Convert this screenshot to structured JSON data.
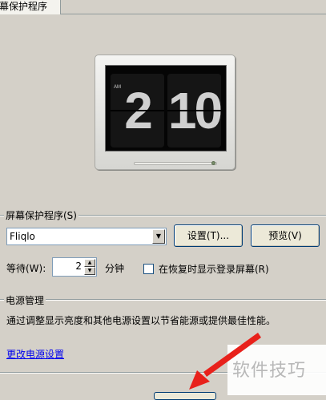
{
  "tab": {
    "label": "幕保护程序"
  },
  "clock": {
    "hours": "2",
    "minutes": "10",
    "ampm": "AM"
  },
  "screensaver_group": {
    "label": "屏幕保护程序(S)",
    "selected": "Fliqlo",
    "settings_button": "设置(T)...",
    "preview_button": "预览(V)",
    "wait_label": "等待(W):",
    "wait_value": "2",
    "wait_unit": "分钟",
    "resume_checkbox_label": "在恢复时显示登录屏幕(R)",
    "resume_checked": false
  },
  "power_group": {
    "label": "电源管理",
    "description": "通过调整显示亮度和其他电源设置以节省能源或提供最佳性能。",
    "link": "更改电源设置"
  },
  "watermark": {
    "text": "软件技巧"
  },
  "colors": {
    "dialog_bg": "#d4d0c8",
    "link": "#0000ee",
    "annotation_arrow": "#e8211b"
  }
}
